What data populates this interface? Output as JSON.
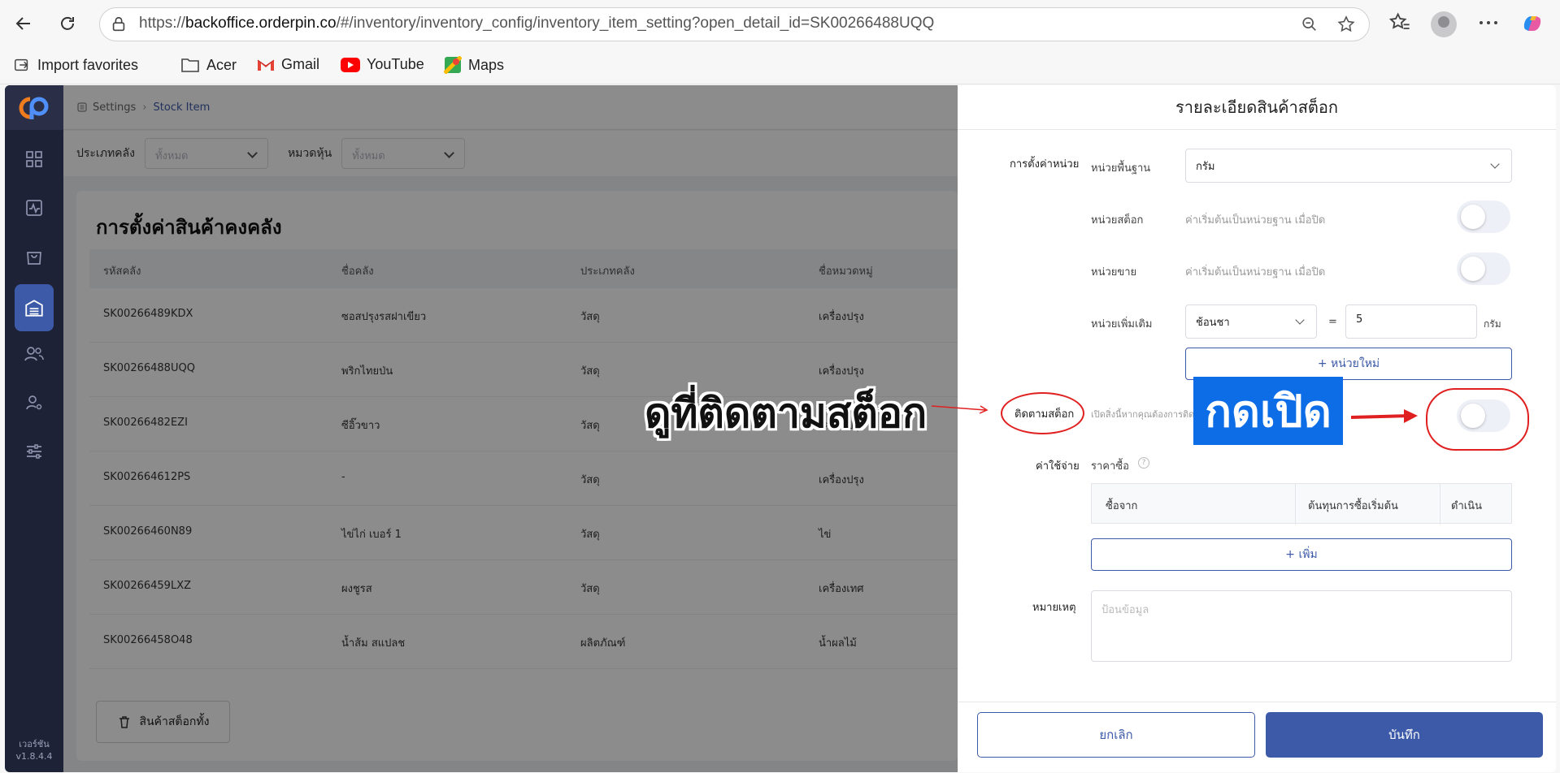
{
  "browser": {
    "url_prefix": "https://",
    "url_domain": "backoffice.orderpin.co",
    "url_path": "/#/inventory/inventory_config/inventory_item_setting?open_detail_id=SK00266488UQQ",
    "bookmarks": [
      "Import favorites",
      "Acer",
      "Gmail",
      "YouTube",
      "Maps"
    ]
  },
  "app": {
    "version_label": "เวอร์ชัน",
    "version": "v1.8.4.4",
    "breadcrumb": {
      "root": "Settings",
      "current": "Stock Item"
    },
    "filters": {
      "type_label": "ประเภทคลัง",
      "type_value": "ทั้งหมด",
      "group_label": "หมวดหุ้น",
      "group_value": "ทั้งหมด"
    },
    "page_title": "การตั้งค่าสินค้าคงคลัง",
    "table": {
      "headers": [
        "รหัสคลัง",
        "ชื่อคลัง",
        "ประเภทคลัง",
        "ชื่อหมวดหมู่"
      ],
      "rows": [
        [
          "SK00266489KDX",
          "ซอสปรุงรสฝาเขียว",
          "วัสดุ",
          "เครื่องปรุง"
        ],
        [
          "SK00266488UQQ",
          "พริกไทยป่น",
          "วัสดุ",
          "เครื่องปรุง"
        ],
        [
          "SK00266482EZI",
          "ซีอิ๊วขาว",
          "วัสดุ",
          "เครื่องปรุง"
        ],
        [
          "SK002664612PS",
          "-",
          "วัสดุ",
          "เครื่องปรุง"
        ],
        [
          "SK00266460N89",
          "ไข่ไก่ เบอร์ 1",
          "วัสดุ",
          "ไข่"
        ],
        [
          "SK00266459LXZ",
          "ผงชูรส",
          "วัสดุ",
          "เครื่องเทศ"
        ],
        [
          "SK00266458O48",
          "น้ำส้ม สแปลช",
          "ผลิตภัณฑ์",
          "น้ำผลไม้"
        ]
      ]
    },
    "all_stock_button": "สินค้าสต็อกทั้ง"
  },
  "drawer": {
    "title": "รายละเอียดสินค้าสต็อก",
    "unit_section_label": "การตั้งค่าหน่วย",
    "base_unit_label": "หน่วยพื้นฐาน",
    "base_unit_value": "กรัม",
    "stock_unit_label": "หน่วยสต็อก",
    "stock_unit_hint": "ค่าเริ่มต้นเป็นหน่วยฐาน เมื่อปิด",
    "sale_unit_label": "หน่วยขาย",
    "sale_unit_hint": "ค่าเริ่มต้นเป็นหน่วยฐาน เมื่อปิด",
    "extra_unit_label": "หน่วยเพิ่มเติม",
    "extra_unit_value": "ช้อนชา",
    "equals": "=",
    "extra_unit_qty": "5",
    "extra_unit_base": "กรัม",
    "new_unit_button": "+ หน่วยใหม่",
    "track_stock_label": "ติดตามสต็อก",
    "track_stock_hint": "เปิดสิ่งนี้หากคุณต้องการติด",
    "cost_label": "ค่าใช้จ่าย",
    "purchase_price_label": "ราคาซื้อ",
    "cost_table_headers": [
      "ซื้อจาก",
      "ต้นทุนการซื้อเริ่มต้น",
      "ดำเนิน"
    ],
    "add_button": "+ เพิ่ม",
    "note_label": "หมายเหตุ",
    "note_placeholder": "ป้อนข้อมูล",
    "cancel_button": "ยกเลิก",
    "save_button": "บันทึก"
  },
  "annotations": {
    "look_text": "ดูที่ติดตามสต็อก",
    "press_text": "กดเปิด",
    "color": "#e02020",
    "box_color": "#0d6de6"
  }
}
